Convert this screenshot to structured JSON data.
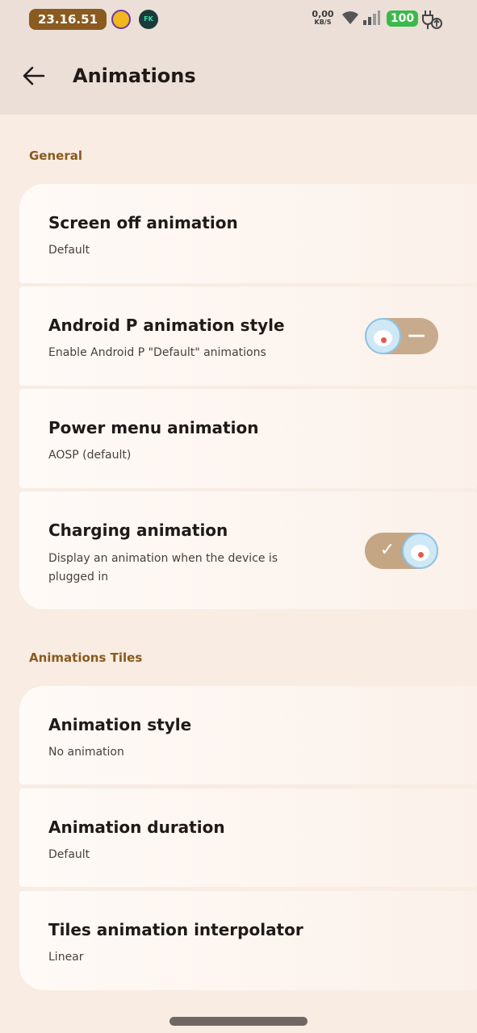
{
  "status_bar": {
    "time": "23.16.51",
    "avatar2_text": "FK",
    "net_speed": "0,00",
    "net_unit": "KB/S",
    "battery": "100"
  },
  "app_bar": {
    "title": "Animations"
  },
  "sections": [
    {
      "header": "General",
      "items": [
        {
          "title": "Screen off animation",
          "summary": "Default"
        },
        {
          "title": "Android P animation style",
          "summary": "Enable Android P \"Default\" animations",
          "toggle": false
        },
        {
          "title": "Power menu animation",
          "summary": "AOSP (default)"
        },
        {
          "title": "Charging animation",
          "summary_line1": "Display an animation when the device is",
          "summary_line2": "plugged in",
          "toggle": true
        }
      ]
    },
    {
      "header": "Animations Tiles",
      "items": [
        {
          "title": "Animation style",
          "summary": "No animation"
        },
        {
          "title": "Animation duration",
          "summary": "Default"
        },
        {
          "title": "Tiles animation interpolator",
          "summary": "Linear"
        }
      ]
    }
  ],
  "colors": {
    "accent": "#8a5a1f",
    "toggle_track": "#c4a584",
    "battery": "#3bba4c"
  }
}
